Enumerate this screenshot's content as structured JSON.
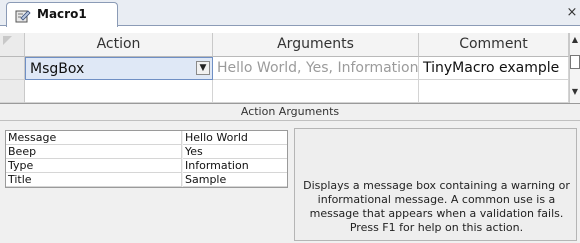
{
  "tab": {
    "title": "Macro1",
    "icon": "macro-icon"
  },
  "close_label": "×",
  "grid": {
    "headers": {
      "action": "Action",
      "arguments": "Arguments",
      "comment": "Comment"
    },
    "rows": [
      {
        "action": "MsgBox",
        "arguments": "Hello World, Yes, Information,",
        "comment": "TinyMacro example"
      }
    ]
  },
  "args_pane": {
    "title": "Action Arguments",
    "fields": [
      {
        "label": "Message",
        "value": "Hello World"
      },
      {
        "label": "Beep",
        "value": "Yes"
      },
      {
        "label": "Type",
        "value": "Information"
      },
      {
        "label": "Title",
        "value": "Sample"
      }
    ],
    "help": "Displays a message box containing a warning or informational message. A common use is a message that appears when a validation fails. Press F1 for help on this action."
  },
  "colors": {
    "selected_cell": "#dfe8f6",
    "selected_border": "#6f8fc4",
    "tab_border": "#8b9bb6"
  }
}
